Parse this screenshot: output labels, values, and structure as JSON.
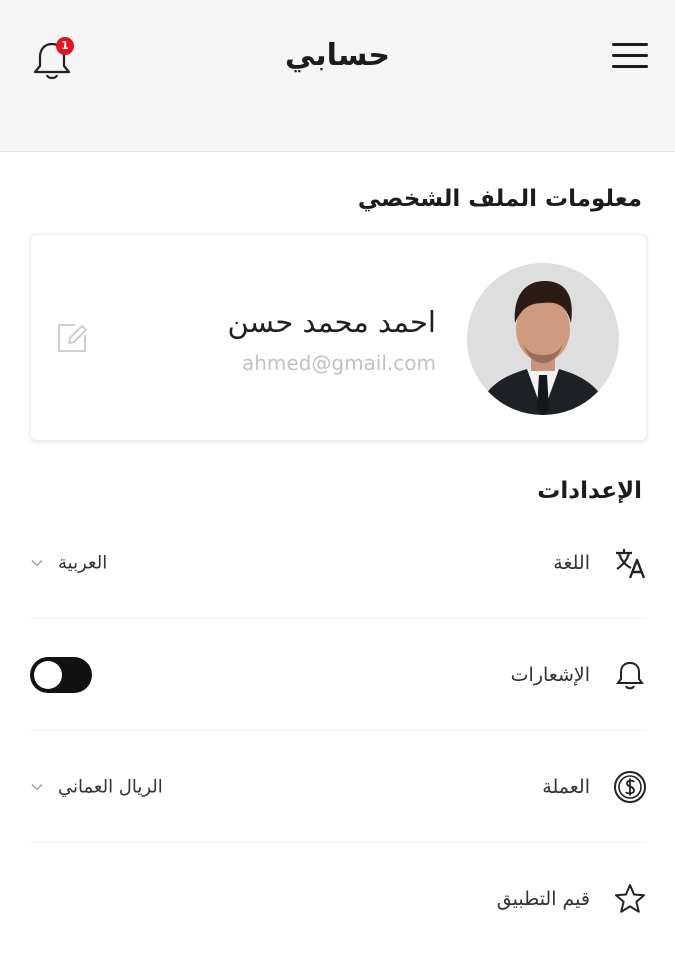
{
  "header": {
    "title": "حسابي",
    "notification_count": "1"
  },
  "profile_section": {
    "title": "معلومات الملف الشخصي",
    "name": "احمد محمد حسن",
    "email": "ahmed@gmail.com"
  },
  "settings_section": {
    "title": "الإعدادات",
    "items": [
      {
        "label": "اللغة",
        "icon": "translate-icon",
        "value": "العربية",
        "control": "dropdown"
      },
      {
        "label": "الإشعارات",
        "icon": "bell-icon",
        "control": "toggle",
        "enabled": false
      },
      {
        "label": "العملة",
        "icon": "currency-icon",
        "value": "الريال العماني",
        "control": "dropdown"
      },
      {
        "label": "قيم التطبيق",
        "icon": "star-icon",
        "control": "link"
      }
    ]
  },
  "colors": {
    "header_bg": "#f5f5f5",
    "badge": "#e5121f",
    "toggle_track": "#111111"
  }
}
